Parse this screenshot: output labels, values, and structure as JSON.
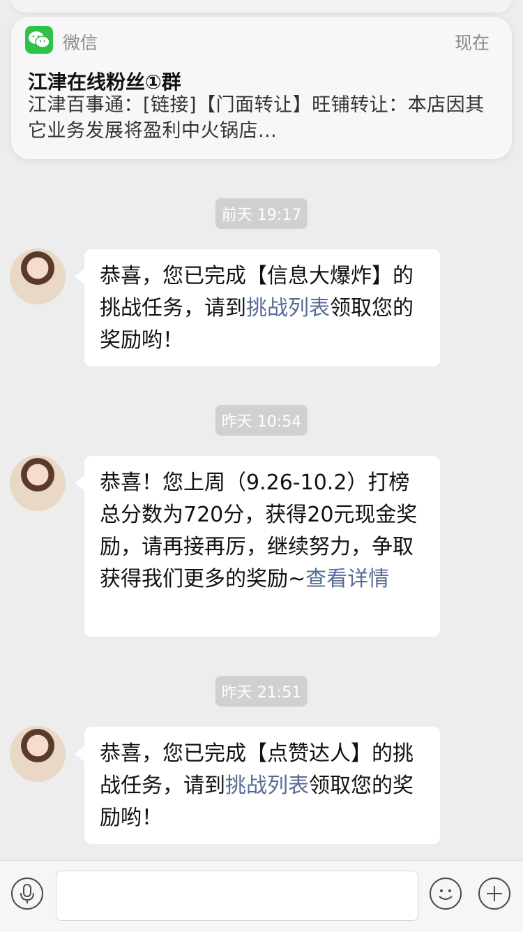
{
  "notification": {
    "app_name": "微信",
    "time": "现在",
    "title": "江津在线粉丝①群",
    "body": "江津百事通：[链接]【门面转让】旺铺转让：本店因其它业务发展将盈利中火锅店..."
  },
  "messages": [
    {
      "timestamp": "前天 19:17",
      "parts": [
        {
          "text": "恭喜，您已完成【信息大爆炸】的挑战任务，请到"
        },
        {
          "text": "挑战列表",
          "link": true
        },
        {
          "text": "领取您的奖励哟！"
        }
      ]
    },
    {
      "timestamp": "昨天 10:54",
      "parts": [
        {
          "text": "恭喜！您上周（9.26-10.2）打榜总分数为720分，获得20元现金奖励，请再接再厉，继续努力，争取获得我们更多的奖励~"
        },
        {
          "text": "查看详情",
          "link": true
        }
      ]
    },
    {
      "timestamp": "昨天 21:51",
      "parts": [
        {
          "text": "恭喜，您已完成【点赞达人】的挑战任务，请到"
        },
        {
          "text": "挑战列表",
          "link": true
        },
        {
          "text": "领取您的奖励哟！"
        }
      ]
    }
  ],
  "input": {
    "placeholder": ""
  },
  "colors": {
    "background": "#ededed",
    "link": "#576b95",
    "wechat_green": "#2fc14a"
  },
  "icons": [
    "wechat-icon",
    "voice-icon",
    "emoji-icon",
    "plus-icon"
  ]
}
